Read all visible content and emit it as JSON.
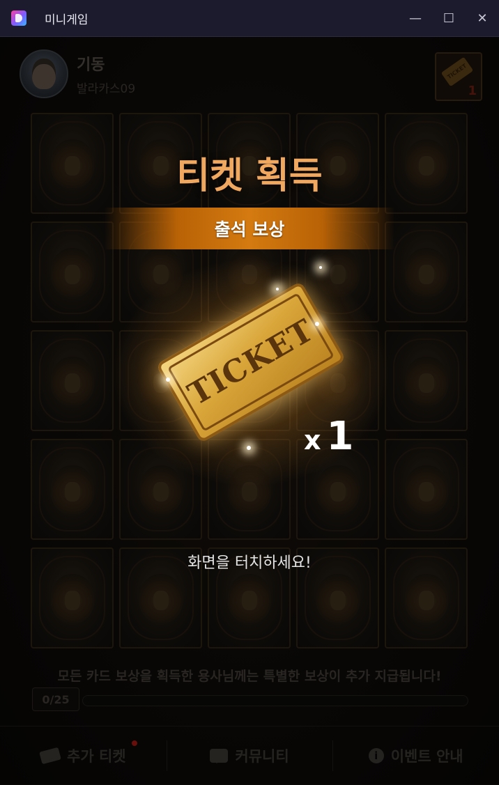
{
  "window": {
    "title": "미니게임",
    "icon": "app-logo-icon",
    "controls": {
      "minimize": "—",
      "maximize": "☐",
      "close": "✕"
    }
  },
  "profile": {
    "nickname": "기동",
    "server": "발라카스09",
    "ticket_badge": {
      "label": "TICKET",
      "count": "1"
    }
  },
  "grid": {
    "rows": 5,
    "columns": 5,
    "card_icon": "lion-head-icon"
  },
  "reward": {
    "title": "티켓 획득",
    "subtitle": "출석 보상",
    "ticket_label": "TICKET",
    "quantity_prefix": "x",
    "quantity": "1",
    "touch_prompt": "화면을 터치하세요!"
  },
  "notice": "모든 카드 보상을 획득한 용사님께는 특별한 보상이 추가 지급됩니다!",
  "progress": {
    "label": "0/25",
    "fraction": 0
  },
  "bottom_nav": [
    {
      "label": "추가 티켓",
      "icon": "ticket-icon",
      "has_badge": true
    },
    {
      "label": "커뮤니티",
      "icon": "chat-icon"
    },
    {
      "label": "이벤트 안내",
      "icon": "info-icon"
    }
  ],
  "colors": {
    "title_bar": "#1c1b2e",
    "reward_title": "#f0a860",
    "banner": "#d47a10",
    "badge_dot": "#a01812"
  }
}
